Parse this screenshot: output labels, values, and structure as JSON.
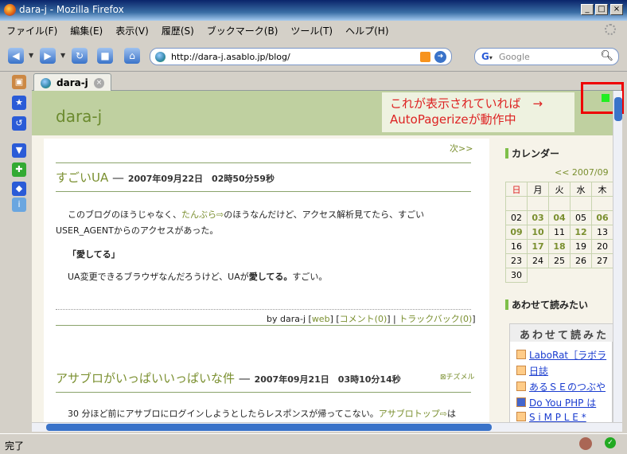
{
  "window": {
    "title": "dara-j - Mozilla Firefox",
    "min": "_",
    "max": "□",
    "close": "×"
  },
  "menu": [
    "ファイル(F)",
    "編集(E)",
    "表示(V)",
    "履歴(S)",
    "ブックマーク(B)",
    "ツール(T)",
    "ヘルプ(H)"
  ],
  "nav": {
    "url": "http://dara-j.asablo.jp/blog/",
    "search_placeholder": "Google"
  },
  "tab": {
    "label": "dara-j"
  },
  "page": {
    "blog_title": "dara-j",
    "notice_line1": "これが表示されていれば　→",
    "notice_line2": "AutoPagerizeが動作中",
    "next_link": "次>>",
    "post1": {
      "title": "すごいUA",
      "dash": "—",
      "date": "2007年09月22日　02時50分59秒",
      "p1a": "このブログのほうじゃなく、",
      "p1link": "たんぶら",
      "p1b": "のほうなんだけど、アクセス解析見てたら、すごい",
      "p1c": "USER_AGENTからのアクセスがあった。",
      "quote": "「愛してる」",
      "p2a": "UA変更できるブラウザなんだろうけど、UAが",
      "p2bold": "愛してる。",
      "p2b": "すごい。",
      "by": "by dara-j",
      "web": "web",
      "comment": "コメント(0)",
      "trackback": "トラックバック(0)"
    },
    "post2": {
      "title": "アサブロがいっぱいいっぱいな件",
      "dash": "—",
      "date": "2007年09月21日　03時10分14秒",
      "chizu": "チズメル",
      "p1a": "30 分ほど前にアサブロにログインしようとしたらレスポンスが帰ってこない。",
      "p1link": "アサブロトップ",
      "p1b": "は"
    }
  },
  "sidebar": {
    "calendar_head": "カレンダー",
    "cal_caption": "<< 2007/09",
    "weekdays": [
      "日",
      "月",
      "火",
      "水",
      "木"
    ],
    "weeks": [
      [
        "",
        "",
        "",
        "",
        ""
      ],
      [
        "02",
        "03",
        "04",
        "05",
        "06"
      ],
      [
        "09",
        "10",
        "11",
        "12",
        "13"
      ],
      [
        "16",
        "17",
        "18",
        "19",
        "20"
      ],
      [
        "23",
        "24",
        "25",
        "26",
        "27"
      ],
      [
        "30",
        "",
        "",
        "",
        ""
      ]
    ],
    "awase_head": "あわせて読みたい",
    "awase_title": "あわせて読みた",
    "awase_items": [
      "LaboRat［ラボラ",
      "日誌",
      "あるＳＥのつぶや",
      "Do You PHP は",
      "S i M P L E *"
    ]
  },
  "status": {
    "text": "完了"
  }
}
